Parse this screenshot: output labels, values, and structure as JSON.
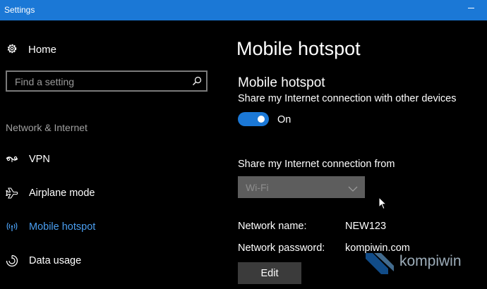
{
  "window": {
    "title": "Settings",
    "accent": "#1b78d6"
  },
  "sidebar": {
    "home": {
      "label": "Home",
      "icon": "gear-icon"
    },
    "search": {
      "placeholder": "Find a setting",
      "icon": "search-icon"
    },
    "section_title": "Network & Internet",
    "items": [
      {
        "label": "VPN",
        "icon": "vpn-icon",
        "active": false
      },
      {
        "label": "Airplane mode",
        "icon": "airplane-icon",
        "active": false
      },
      {
        "label": "Mobile hotspot",
        "icon": "hotspot-icon",
        "active": true
      },
      {
        "label": "Data usage",
        "icon": "data-usage-icon",
        "active": false
      }
    ],
    "active_color": "#4a9ef0"
  },
  "main": {
    "page_title": "Mobile hotspot",
    "section_heading": "Mobile hotspot",
    "share_description": "Share my Internet connection with other devices",
    "toggle": {
      "state": "on",
      "label": "On"
    },
    "share_from": {
      "label": "Share my Internet connection from",
      "selected": "Wi-Fi"
    },
    "network_name": {
      "label": "Network name:",
      "value": "NEW123"
    },
    "network_password": {
      "label": "Network password:",
      "value": "kompiwin.com"
    },
    "edit_button": "Edit"
  },
  "watermark": {
    "text": "kompiwin"
  }
}
